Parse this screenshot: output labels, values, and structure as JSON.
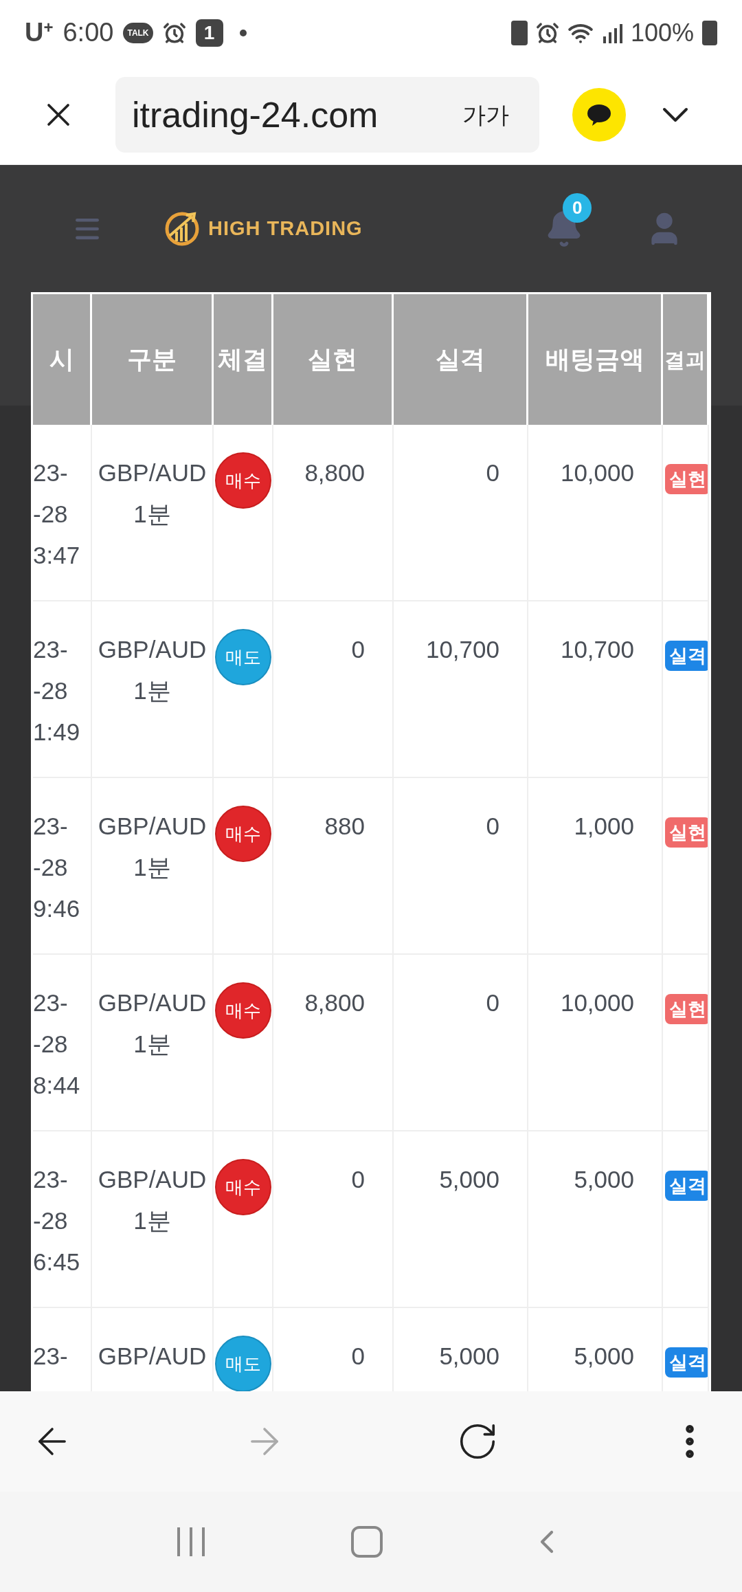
{
  "status_bar": {
    "carrier": "U",
    "carrier_mark": "+",
    "time": "6:00",
    "talk_label": "TALK",
    "notification_count": "1",
    "battery": "100%"
  },
  "browser": {
    "url": "itrading-24.com",
    "text_size": "가가"
  },
  "site_header": {
    "brand": "HIGH TRADING",
    "notifications": "0"
  },
  "table": {
    "columns": [
      "시",
      "구분",
      "체결",
      "실현",
      "실격",
      "배팅금액",
      "결괴"
    ],
    "rows": [
      {
        "date": [
          "23-",
          "-28",
          "3:47"
        ],
        "instrument": "GBP/AUD",
        "period": "1분",
        "order": {
          "label": "매수",
          "kind": "buy"
        },
        "realized": "8,800",
        "lost": "0",
        "bet": "10,000",
        "result": {
          "label": "실현",
          "kind": "win"
        }
      },
      {
        "date": [
          "23-",
          "-28",
          "1:49"
        ],
        "instrument": "GBP/AUD",
        "period": "1분",
        "order": {
          "label": "매도",
          "kind": "sell"
        },
        "realized": "0",
        "lost": "10,700",
        "bet": "10,700",
        "result": {
          "label": "실격",
          "kind": "loss"
        }
      },
      {
        "date": [
          "23-",
          "-28",
          "9:46"
        ],
        "instrument": "GBP/AUD",
        "period": "1분",
        "order": {
          "label": "매수",
          "kind": "buy"
        },
        "realized": "880",
        "lost": "0",
        "bet": "1,000",
        "result": {
          "label": "실현",
          "kind": "win"
        }
      },
      {
        "date": [
          "23-",
          "-28",
          "8:44"
        ],
        "instrument": "GBP/AUD",
        "period": "1분",
        "order": {
          "label": "매수",
          "kind": "buy"
        },
        "realized": "8,800",
        "lost": "0",
        "bet": "10,000",
        "result": {
          "label": "실현",
          "kind": "win"
        }
      },
      {
        "date": [
          "23-",
          "-28",
          "6:45"
        ],
        "instrument": "GBP/AUD",
        "period": "1분",
        "order": {
          "label": "매수",
          "kind": "buy"
        },
        "realized": "0",
        "lost": "5,000",
        "bet": "5,000",
        "result": {
          "label": "실격",
          "kind": "loss"
        }
      },
      {
        "date": [
          "23-"
        ],
        "instrument": "GBP/AUD",
        "order": {
          "label": "매도",
          "kind": "sell"
        },
        "realized": "0",
        "lost": "5,000",
        "bet": "5,000",
        "result": {
          "label": "실격",
          "kind": "loss"
        }
      }
    ]
  }
}
